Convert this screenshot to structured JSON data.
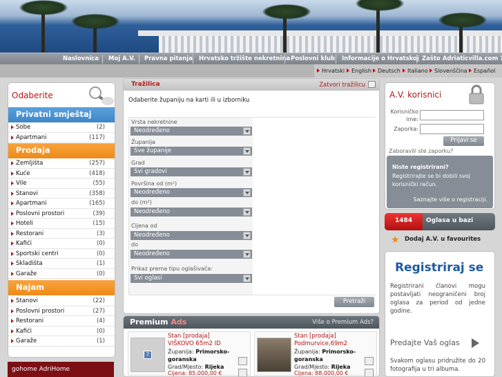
{
  "nav": [
    "Naslovnica",
    "Moj A.V.",
    "Pravna pitanja",
    "Hrvatsko tržište nekretnina",
    "Poslovni klub",
    "Informacije o Hrvatskoj",
    "Zašto Adriaticvilla.com ?"
  ],
  "languages": [
    "Hrvatski",
    "English",
    "Deutsch",
    "Italiano",
    "Slovenščina",
    "Español"
  ],
  "left": {
    "title": "Odaberite",
    "sections": [
      {
        "label": "Privatni smještaj",
        "color": "blue",
        "items": [
          {
            "label": "Sobe",
            "count": "(2)"
          },
          {
            "label": "Apartmani",
            "count": "(117)"
          }
        ]
      },
      {
        "label": "Prodaja",
        "color": "orange",
        "items": [
          {
            "label": "Zemljišta",
            "count": "(257)"
          },
          {
            "label": "Kuće",
            "count": "(418)"
          },
          {
            "label": "Vile",
            "count": "(55)"
          },
          {
            "label": "Stanovi",
            "count": "(358)"
          },
          {
            "label": "Apartmani",
            "count": "(165)"
          },
          {
            "label": "Poslovni prostori",
            "count": "(39)"
          },
          {
            "label": "Hoteli",
            "count": "(15)"
          },
          {
            "label": "Restorani",
            "count": "(3)"
          },
          {
            "label": "Kafići",
            "count": "(0)"
          },
          {
            "label": "Sportski centri",
            "count": "(0)"
          },
          {
            "label": "Skladišta",
            "count": "(1)"
          },
          {
            "label": "Garaže",
            "count": "(0)"
          }
        ]
      },
      {
        "label": "Najam",
        "color": "orange",
        "items": [
          {
            "label": "Stanovi",
            "count": "(22)"
          },
          {
            "label": "Poslovni prostori",
            "count": "(27)"
          },
          {
            "label": "Restorani",
            "count": "(4)"
          },
          {
            "label": "Kafići",
            "count": "(0)"
          },
          {
            "label": "Garaže",
            "count": "(1)"
          }
        ]
      }
    ],
    "banner": "gohome AdriHome"
  },
  "search": {
    "title": "Tražilica",
    "close": "Zatvori tražilicu",
    "intro": "Odaberite županiju na karti ili u izborniku",
    "fields": [
      {
        "label": "Vrsta nekretnine",
        "value": "Neodređeno"
      },
      {
        "label": "Županija",
        "value": "Sve županije"
      },
      {
        "label": "Grad",
        "value": "Svi gradovi"
      },
      {
        "label": "Površina od (m²)",
        "value": "Neodređeno"
      },
      {
        "label": "do (m²)",
        "value": "Neodređeno"
      },
      {
        "label": "Cijena od",
        "value": "Neodređeno"
      },
      {
        "label": "do",
        "value": "Neodređeno"
      },
      {
        "label": "Prikaz prema tipu oglašivača:",
        "value": "Svi oglasi"
      }
    ],
    "submit": "Pretraži"
  },
  "premium": {
    "title": "Premium",
    "title_accent": "Ads",
    "more": "Više o Premium Ads?",
    "ads": [
      {
        "title": "Stan [prodaja] VIŠKOVO 65m2 ID",
        "county_label": "Županija:",
        "county": "Primorsko-goranska",
        "city_label": "Grad/Mjesto:",
        "city": "Rijeka",
        "price": "Cijena: 85.000,00 €"
      },
      {
        "title": "Stan [prodaja] Podmurvice,69m2",
        "county_label": "Županija:",
        "county": "Primorsko-goranska",
        "city_label": "Grad/Mjesto:",
        "city": "Rijeka",
        "price": "Cijena: 88.000,00 €"
      }
    ]
  },
  "users": {
    "title": "A.V. korisnici",
    "username_label": "Korisničko ime:",
    "password_label": "Zaporka:",
    "login": "Prijavi se",
    "forgot": "Zaboravili ste zaporku?",
    "not_registered": "Niste registrirani?",
    "register_text": "Registrirajte se bi dobili svoj korisnički račun.",
    "more": "Saznajte više o registraciji."
  },
  "ad_count": {
    "number": "1484",
    "label": "Oglasa u bazi"
  },
  "favourite": "Dodaj A.V. u favourites",
  "register_box": {
    "title": "Registriraj se",
    "text": "Registrirani članovi mogu postavljati neograničeni broj oglasa za period od jedne godine.",
    "sell": "Predajte Vaš oglas",
    "text2": "Svakom oglasu pridružite do 20 fotografija u tri albuma."
  },
  "colors": {
    "accent_red": "#b41818",
    "blue": "#3f86c7",
    "orange": "#ee8a19",
    "gray": "#868d96"
  }
}
